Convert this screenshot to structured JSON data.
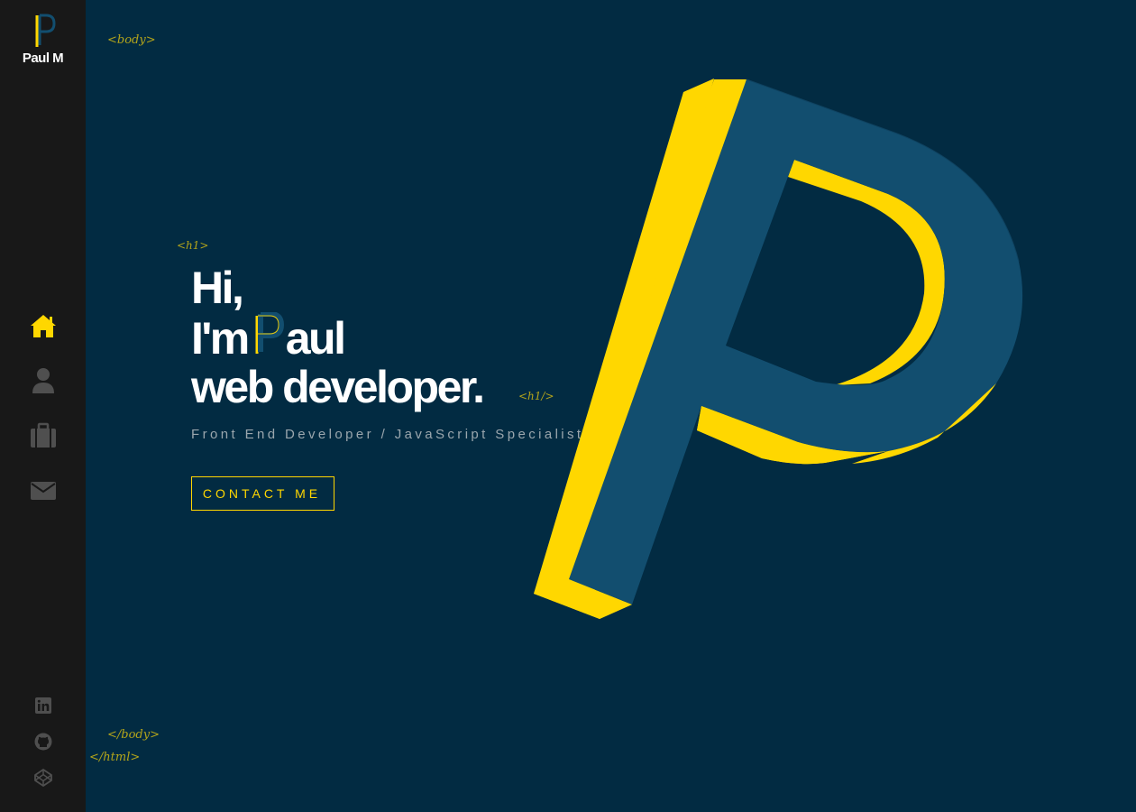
{
  "brand": {
    "logo_text": "Paul M",
    "colors": {
      "accent": "#ffd700",
      "background": "#022b42",
      "sidebar": "#181818",
      "p_blue": "#124e6f"
    }
  },
  "nav": {
    "items": [
      {
        "id": "home",
        "icon": "home-icon",
        "active": true
      },
      {
        "id": "about",
        "icon": "user-icon",
        "active": false
      },
      {
        "id": "work",
        "icon": "briefcase-icon",
        "active": false
      },
      {
        "id": "contact",
        "icon": "envelope-icon",
        "active": false
      }
    ]
  },
  "social": {
    "items": [
      {
        "id": "linkedin",
        "icon": "linkedin-icon"
      },
      {
        "id": "github",
        "icon": "github-icon"
      },
      {
        "id": "codepen",
        "icon": "codepen-icon"
      }
    ]
  },
  "tags": {
    "body_open": "<body>",
    "h1_open": "<h1>",
    "h1_close": "<h1/>",
    "body_close": "</body>",
    "html_close": "</html>"
  },
  "hero": {
    "line1": "Hi,",
    "line2_prefix": "I'm",
    "line2_suffix": "aul",
    "line3": "web developer."
  },
  "subtitle": "Front End Developer / JavaScript Specialist",
  "contact_button": "CONTACT ME"
}
